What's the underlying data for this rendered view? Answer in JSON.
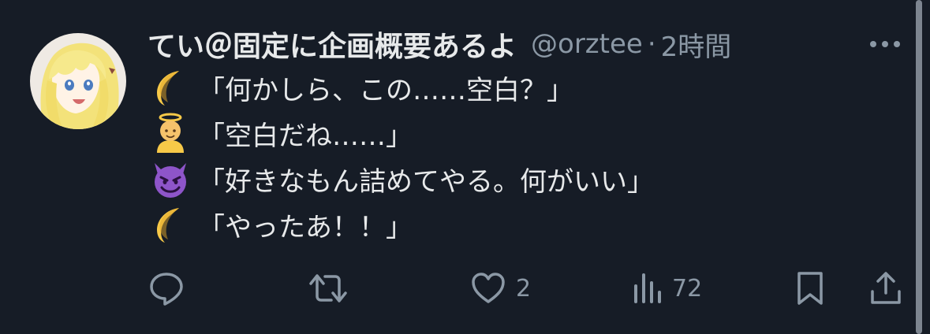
{
  "tweet": {
    "display_name": "てい＠固定に企画概要あるよ",
    "handle": "@orztee",
    "separator": "·",
    "time": "2時間",
    "lines": [
      {
        "emoji": "crescent-moon",
        "text": "「何かしら、この……空白？」"
      },
      {
        "emoji": "baby-angel",
        "text": "「空白だね……」"
      },
      {
        "emoji": "smiling-imp",
        "text": "「好きなもん詰めてやる。何がいい」"
      },
      {
        "emoji": "crescent-moon",
        "text": "「やったあ！！」"
      }
    ]
  },
  "actions": {
    "reply": {
      "icon": "reply-icon",
      "count": ""
    },
    "repost": {
      "icon": "repost-icon",
      "count": ""
    },
    "like": {
      "icon": "heart-icon",
      "count": "2"
    },
    "views": {
      "icon": "views-icon",
      "count": "72"
    },
    "bookmark": {
      "icon": "bookmark-icon"
    },
    "share": {
      "icon": "share-icon"
    }
  },
  "colors": {
    "background": "#161c26",
    "primary_text": "#e7e9ea",
    "secondary_text": "#8b98a5"
  }
}
